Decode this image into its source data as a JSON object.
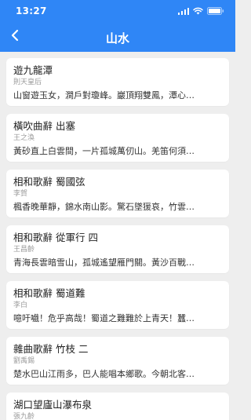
{
  "status": {
    "time": "13:27"
  },
  "header": {
    "title": "山水"
  },
  "items": [
    {
      "title": "遊九龍潭",
      "author": "則天皇后",
      "excerpt": "山窗遊玉女，澗戶對瓊峰。巖頂翔雙鳳，潭心…"
    },
    {
      "title": "橫吹曲辭 出塞",
      "author": "王之渙",
      "excerpt": "黃砂直上白雲間，一片孤城萬仞山。羌笛何須…"
    },
    {
      "title": "相和歌辭 蜀國弦",
      "author": "李賀",
      "excerpt": "楓香晚華靜，錦水南山影。驚石墜猨哀，竹雲…"
    },
    {
      "title": "相和歌辭 從軍行 四",
      "author": "王昌齡",
      "excerpt": "青海長雲暗雪山，孤城遙望雁門關。黃沙百戰…"
    },
    {
      "title": "相和歌辭 蜀道難",
      "author": "李白",
      "excerpt": "噫吁嚱！危乎高哉！蜀道之難難於上青天！蠶…"
    },
    {
      "title": "雜曲歌辭 竹枝 二",
      "author": "劉禹錫",
      "excerpt": "楚水巴山江雨多，巴人能唱本鄉歌。今朝北客…"
    },
    {
      "title": "湖口望廬山瀑布泉",
      "author": "張九齡",
      "excerpt": ""
    }
  ],
  "icons": {
    "back": "chevron-left-icon",
    "signal": "cellular-signal-icon",
    "wifi": "wifi-icon",
    "battery": "battery-icon"
  },
  "colors": {
    "header_bg": "#2f86f6",
    "page_bg": "#eeeeee",
    "card_bg": "#ffffff"
  }
}
